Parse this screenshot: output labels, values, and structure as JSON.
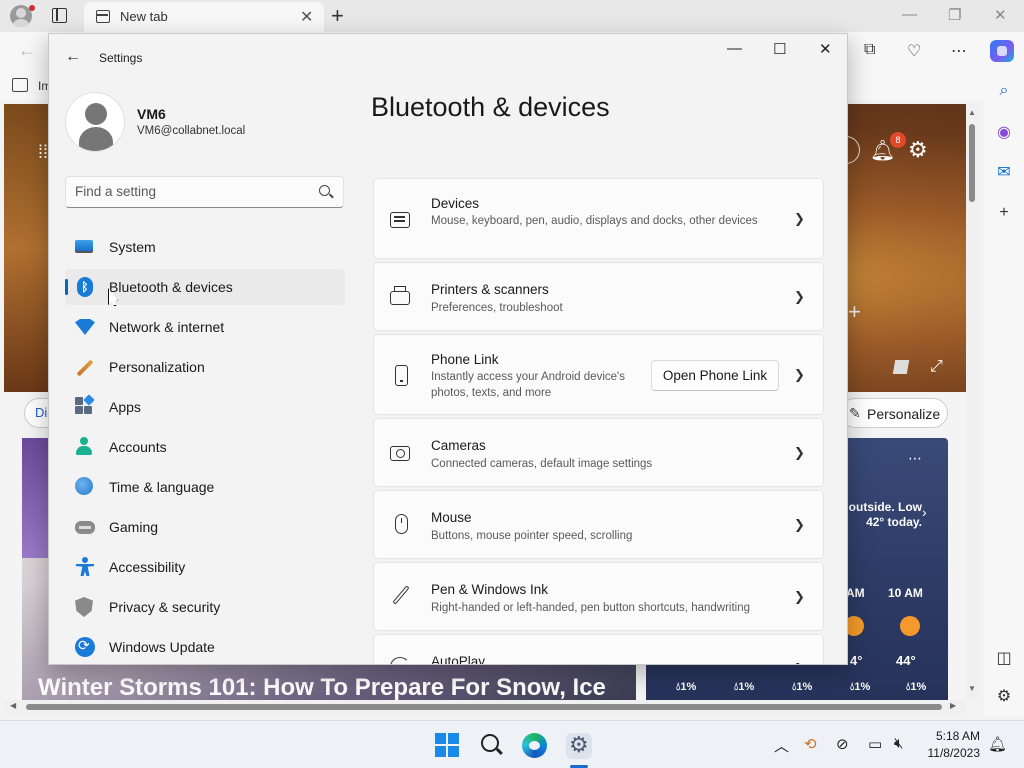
{
  "browser": {
    "tab_title": "New tab",
    "favorites_label": "Im"
  },
  "page": {
    "notification_count": "8",
    "chip_label": "Di",
    "personalize_label": "Personalize",
    "headline": "Winter Storms 101: How To Prepare For Snow, Ice",
    "weather": {
      "summary": "outside. Low 42° today.",
      "hours": [
        {
          "label": "AM",
          "temp": "4°",
          "precip": "1%"
        },
        {
          "label": "10 AM",
          "temp": "44°",
          "precip": "1%"
        }
      ],
      "precip_values": [
        "1%",
        "1%",
        "1%",
        "1%",
        "1%"
      ]
    }
  },
  "settings": {
    "window_title": "Settings",
    "user": {
      "name": "VM6",
      "email": "VM6@collabnet.local"
    },
    "search_placeholder": "Find a setting",
    "nav": [
      {
        "label": "System",
        "icon": "monitor-icon"
      },
      {
        "label": "Bluetooth & devices",
        "icon": "bluetooth-icon",
        "selected": true
      },
      {
        "label": "Network & internet",
        "icon": "wifi-icon"
      },
      {
        "label": "Personalization",
        "icon": "brush-icon"
      },
      {
        "label": "Apps",
        "icon": "apps-icon"
      },
      {
        "label": "Accounts",
        "icon": "person-icon"
      },
      {
        "label": "Time & language",
        "icon": "globe-clock-icon"
      },
      {
        "label": "Gaming",
        "icon": "gamepad-icon"
      },
      {
        "label": "Accessibility",
        "icon": "accessibility-icon"
      },
      {
        "label": "Privacy & security",
        "icon": "shield-icon"
      },
      {
        "label": "Windows Update",
        "icon": "update-icon"
      }
    ],
    "page_title": "Bluetooth & devices",
    "cards": [
      {
        "title": "Devices",
        "desc": "Mouse, keyboard, pen, audio, displays and docks, other devices",
        "icon": "keyboard-icon"
      },
      {
        "title": "Printers & scanners",
        "desc": "Preferences, troubleshoot",
        "icon": "printer-icon"
      },
      {
        "title": "Phone Link",
        "desc": "Instantly access your Android device's photos, texts, and more",
        "button": "Open Phone Link",
        "icon": "phone-icon"
      },
      {
        "title": "Cameras",
        "desc": "Connected cameras, default image settings",
        "icon": "camera-icon"
      },
      {
        "title": "Mouse",
        "desc": "Buttons, mouse pointer speed, scrolling",
        "icon": "mouse-icon"
      },
      {
        "title": "Pen & Windows Ink",
        "desc": "Right-handed or left-handed, pen button shortcuts, handwriting",
        "icon": "pen-icon"
      },
      {
        "title": "AutoPlay",
        "desc": "",
        "icon": "autoplay-icon"
      }
    ]
  },
  "taskbar": {
    "time": "5:18 AM",
    "date": "11/8/2023"
  },
  "colors": {
    "accent": "#0067c0",
    "weather_bg": "#2c3a64",
    "taskbar_bg": "#eef1f6"
  }
}
